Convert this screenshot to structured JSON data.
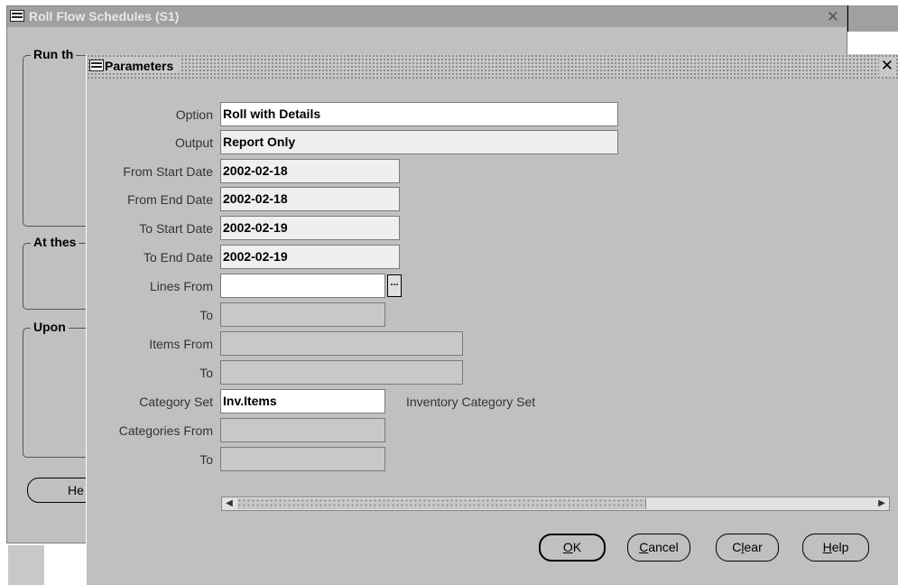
{
  "background_window": {
    "title": "Roll Flow Schedules (S1)",
    "groups": [
      "Run this Request",
      "At these Times",
      "Upon Completion"
    ],
    "groups_visible": [
      "Run th",
      "At thes",
      "Upon"
    ],
    "button_visible": "He"
  },
  "dialog": {
    "title": "Parameters",
    "fields": {
      "option": {
        "label": "Option",
        "value": "Roll with Details"
      },
      "output": {
        "label": "Output",
        "value": "Report Only"
      },
      "from_start_date": {
        "label": "From Start Date",
        "value": "2002-02-18"
      },
      "from_end_date": {
        "label": "From End Date",
        "value": "2002-02-18"
      },
      "to_start_date": {
        "label": "To Start Date",
        "value": "2002-02-19"
      },
      "to_end_date": {
        "label": "To End Date",
        "value": "2002-02-19"
      },
      "lines_from": {
        "label": "Lines From",
        "value": ""
      },
      "lines_to": {
        "label": "To",
        "value": ""
      },
      "items_from": {
        "label": "Items From",
        "value": ""
      },
      "items_to": {
        "label": "To",
        "value": ""
      },
      "category_set": {
        "label": "Category Set",
        "value": "Inv.Items",
        "description": "Inventory Category Set"
      },
      "categories_from": {
        "label": "Categories From",
        "value": ""
      },
      "categories_to": {
        "label": "To",
        "value": ""
      }
    },
    "lov_button": "...",
    "buttons": {
      "ok": {
        "mnemonic": "O",
        "rest": "K"
      },
      "cancel": {
        "mnemonic": "C",
        "rest": "ancel"
      },
      "clear": {
        "pre": "C",
        "mnemonic": "l",
        "rest": "ear"
      },
      "help": {
        "mnemonic": "H",
        "rest": "elp"
      }
    }
  },
  "icons": [
    "app-icon",
    "close-icon",
    "scroll-left-icon",
    "scroll-right-icon"
  ],
  "colors": {
    "window": "#c0c0c0",
    "field_white": "#ffffff",
    "field_pale": "#efefef",
    "field_disabled": "#c8c8c8"
  }
}
